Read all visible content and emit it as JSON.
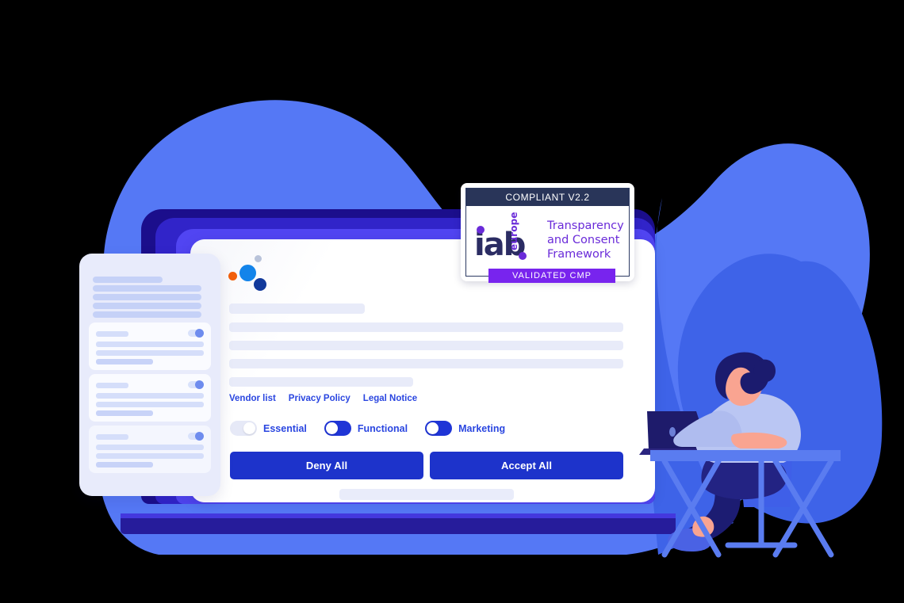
{
  "scene": {
    "title": "Consent Management Platform banner illustration",
    "colors": {
      "blob_light": "#5578F5",
      "blob_dark": "#3E63E8",
      "laptop_outer": "#1B0E8C",
      "laptop_mid": "#3124C9",
      "laptop_inner": "#5145F2",
      "laptop_base": "#261C9B",
      "accent_blue": "#1D33CB",
      "link_blue": "#2A46E0",
      "placeholder": "#E8EBF9",
      "panel_bg": "#E8EBFB",
      "badge_header": "#293559",
      "badge_purple": "#7824EE",
      "iab_navy": "#2B2C63",
      "iab_purple": "#6A2BD9",
      "skin": "#F9A491",
      "shirt": "#BAC6F3",
      "hair": "#1B1B6E",
      "desk": "#5A7CF0"
    }
  },
  "banner": {
    "logo_dots": [
      "orange-dot",
      "cyan-dot",
      "navy-dot",
      "pale-dot"
    ],
    "links": [
      {
        "label": "Vendor list"
      },
      {
        "label": "Privacy Policy"
      },
      {
        "label": "Legal Notice"
      }
    ],
    "toggles": [
      {
        "label": "Essential",
        "state": "off"
      },
      {
        "label": "Functional",
        "state": "on"
      },
      {
        "label": "Marketing",
        "state": "on"
      }
    ],
    "buttons": {
      "deny": "Deny All",
      "accept": "Accept All"
    }
  },
  "badge": {
    "header": "COMPLIANT V2.2",
    "logo_word": "iab",
    "logo_region": "europe",
    "framework_line1": "Transparency",
    "framework_line2": "and Consent",
    "framework_line3": "Framework",
    "footer": "VALIDATED CMP"
  },
  "panel": {
    "cards": 3
  }
}
